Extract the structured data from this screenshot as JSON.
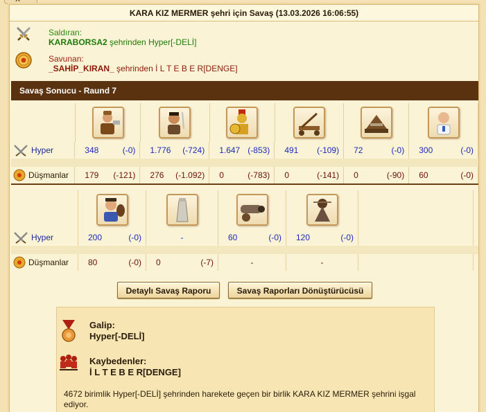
{
  "close": "✕",
  "title": "KARA KIZ MERMER şehri için Savaş (13.03.2026 16:06:55)",
  "attacker": {
    "role": "Saldıran:",
    "city": "KARABORSA2",
    "middle": " şehrinden ",
    "player": "Hyper[-DELİ]"
  },
  "defender": {
    "role": "Savunan:",
    "city": "_SAHİP_KIRAN_",
    "middle": " şehrinden ",
    "player": "İ L T E B E R[DENGE]"
  },
  "result_header": "Savaş Sonucu - Raund 7",
  "rows": {
    "hyper_label": "Hyper",
    "enemy_label": "Düşmanlar"
  },
  "grid1": {
    "units": [
      "swordsman-unit-icon",
      "slinger-unit-icon",
      "hoplite-unit-icon",
      "catapult-unit-icon",
      "ram-unit-icon",
      "doctor-unit-icon"
    ],
    "hyper": [
      {
        "count": "348",
        "loss": "(-0)"
      },
      {
        "count": "1.776",
        "loss": "(-724)"
      },
      {
        "count": "1.647",
        "loss": "(-853)"
      },
      {
        "count": "491",
        "loss": "(-109)"
      },
      {
        "count": "72",
        "loss": "(-0)"
      },
      {
        "count": "300",
        "loss": "(-0)"
      }
    ],
    "enemy": [
      {
        "count": "179",
        "loss": "(-121)"
      },
      {
        "count": "276",
        "loss": "(-1.092)"
      },
      {
        "count": "0",
        "loss": "(-783)"
      },
      {
        "count": "0",
        "loss": "(-141)"
      },
      {
        "count": "0",
        "loss": "(-90)"
      },
      {
        "count": "60",
        "loss": "(-0)"
      }
    ]
  },
  "grid2": {
    "units": [
      "cook-unit-icon",
      "wall-icon",
      "cannon-unit-icon",
      "mortar-unit-icon"
    ],
    "hyper": [
      {
        "count": "200",
        "loss": "(-0)"
      },
      {
        "count": "-",
        "loss": ""
      },
      {
        "count": "60",
        "loss": "(-0)"
      },
      {
        "count": "120",
        "loss": "(-0)"
      }
    ],
    "enemy": [
      {
        "count": "80",
        "loss": "(-0)"
      },
      {
        "count": "0",
        "loss": "(-7)"
      },
      {
        "count": "-",
        "loss": ""
      },
      {
        "count": "-",
        "loss": ""
      }
    ]
  },
  "buttons": {
    "detail": "Detaylı Savaş Raporu",
    "converter": "Savaş Raporları Dönüştürücüsü"
  },
  "summary": {
    "winner_label": "Galip:",
    "winner": "Hyper[-DELİ]",
    "loser_label": "Kaybedenler:",
    "loser": "İ L T E B E R[DENGE]",
    "text": "4672 birimlik Hyper[-DELİ] şehrinden harekete geçen bir birlik KARA KIZ MERMER şehrini işgal ediyor."
  },
  "colors": {
    "header_bar": "#5a3210",
    "attacker_text": "#1d7a08",
    "defender_text": "#8a1a08",
    "hyper_values": "#1a2abf"
  }
}
